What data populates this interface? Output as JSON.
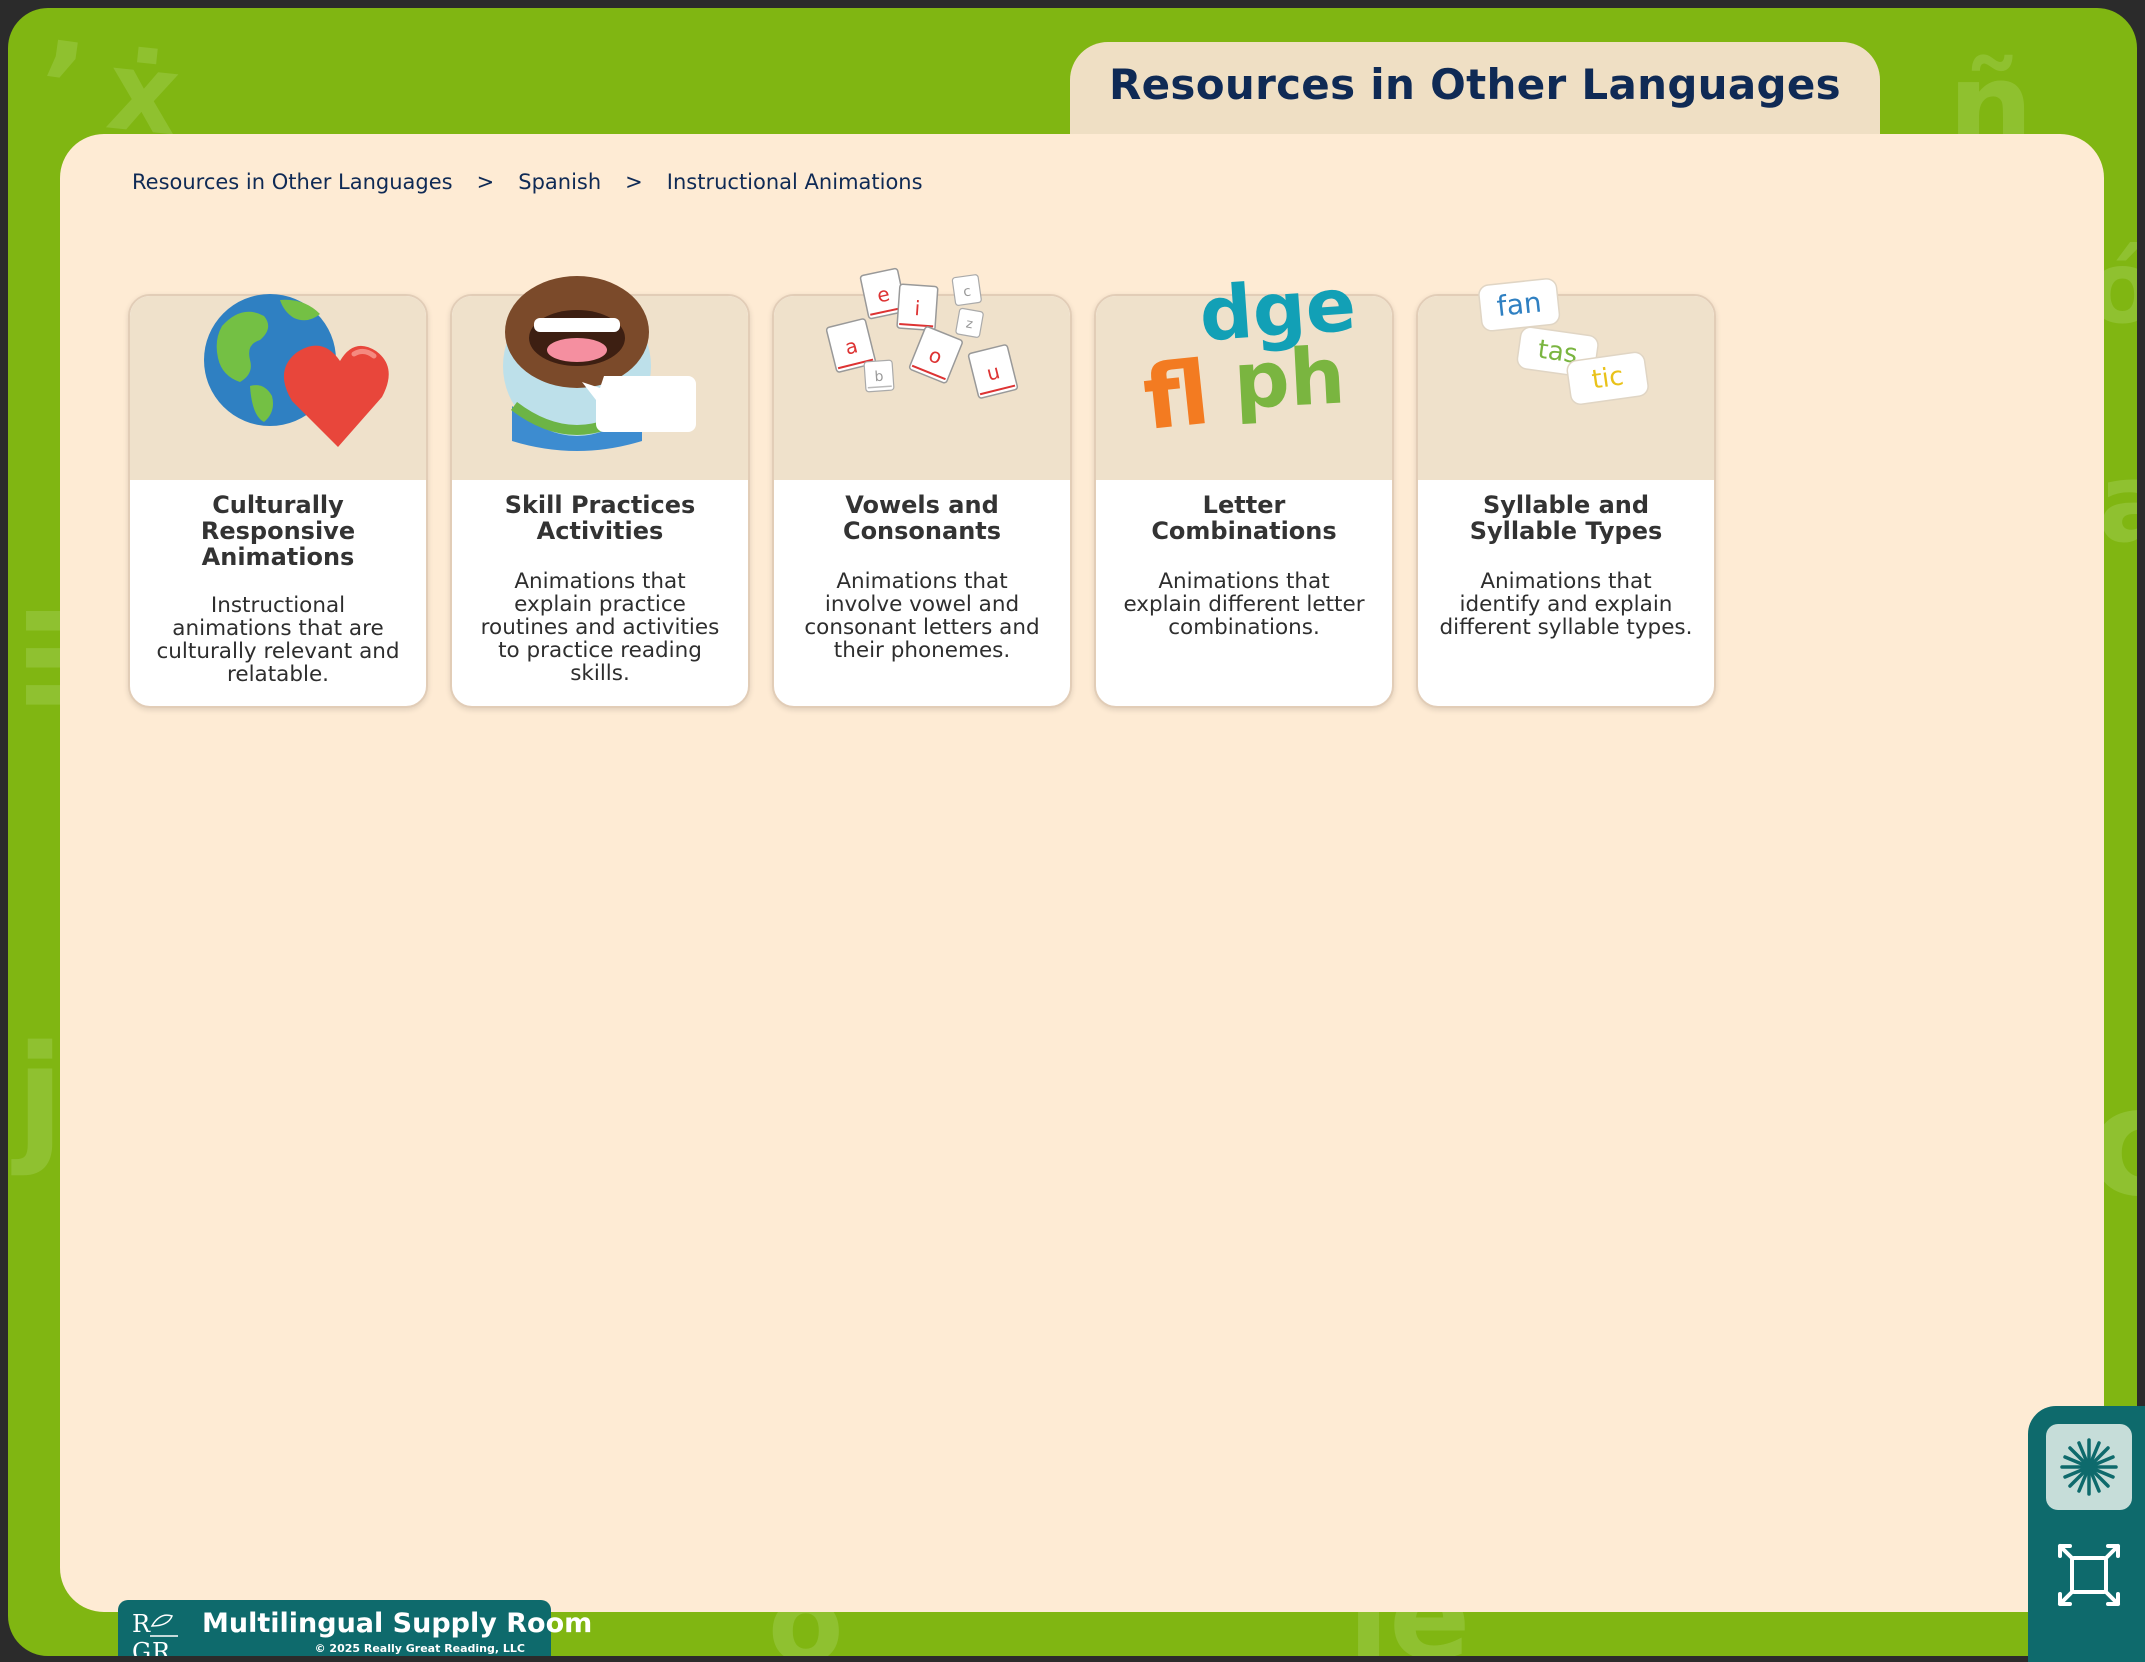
{
  "header": {
    "title": "Resources in Other Languages"
  },
  "breadcrumb": {
    "items": [
      "Resources in Other Languages",
      "Spanish",
      "Instructional Animations"
    ],
    "separator": ">"
  },
  "cards": [
    {
      "title": "Culturally Responsive Animations",
      "title_lines": [
        "Culturally",
        "Responsive",
        "Animations"
      ],
      "description_lines": [
        "Instructional",
        "animations that are",
        "culturally relevant and",
        "relatable."
      ],
      "icon": "globe-heart-icon"
    },
    {
      "title": "Skill Practices Activities",
      "title_lines": [
        "Skill Practices",
        "Activities"
      ],
      "description_lines": [
        "Animations that",
        "explain practice",
        "routines and activities",
        "to practice reading",
        "skills."
      ],
      "icon": "speaking-mouth-icon"
    },
    {
      "title": "Vowels and Consonants",
      "title_lines": [
        "Vowels and",
        "Consonants"
      ],
      "description_lines": [
        "Animations that",
        "involve vowel and",
        "consonant letters and",
        "their phonemes."
      ],
      "icon": "letter-cards-icon",
      "art_letters": [
        "e",
        "i",
        "c",
        "a",
        "z",
        "o",
        "b",
        "u"
      ]
    },
    {
      "title": "Letter Combinations",
      "title_lines": [
        "Letter",
        "Combinations"
      ],
      "description_lines": [
        "Animations that",
        "explain different letter",
        "combinations."
      ],
      "icon": "letter-combinations-icon",
      "art_letters": [
        "dge",
        "fl",
        "ph"
      ]
    },
    {
      "title": "Syllable and Syllable Types",
      "title_lines": [
        "Syllable and",
        "Syllable Types"
      ],
      "description_lines": [
        "Animations that",
        "identify and explain",
        "different syllable types."
      ],
      "icon": "syllable-cards-icon",
      "art_letters": [
        "fan",
        "tas",
        "tic"
      ]
    }
  ],
  "tools": {
    "star_icon": "sparkle-icon",
    "fullscreen_icon": "fullscreen-icon"
  },
  "footer": {
    "logo_text": [
      "R",
      "G",
      "R"
    ],
    "brand_name": "Multilingual Supply Room",
    "copyright": "© 2025 Really Great Reading, LLC"
  },
  "colors": {
    "frame_green": "#80b612",
    "panel_cream": "#feebd4",
    "title_tab": "#efdfc4",
    "navy_text": "#0f2a55",
    "teal": "#0e6a6c",
    "orange": "#f37b21",
    "green_letters": "#7ab540",
    "cyan_letters": "#12a0b6"
  }
}
